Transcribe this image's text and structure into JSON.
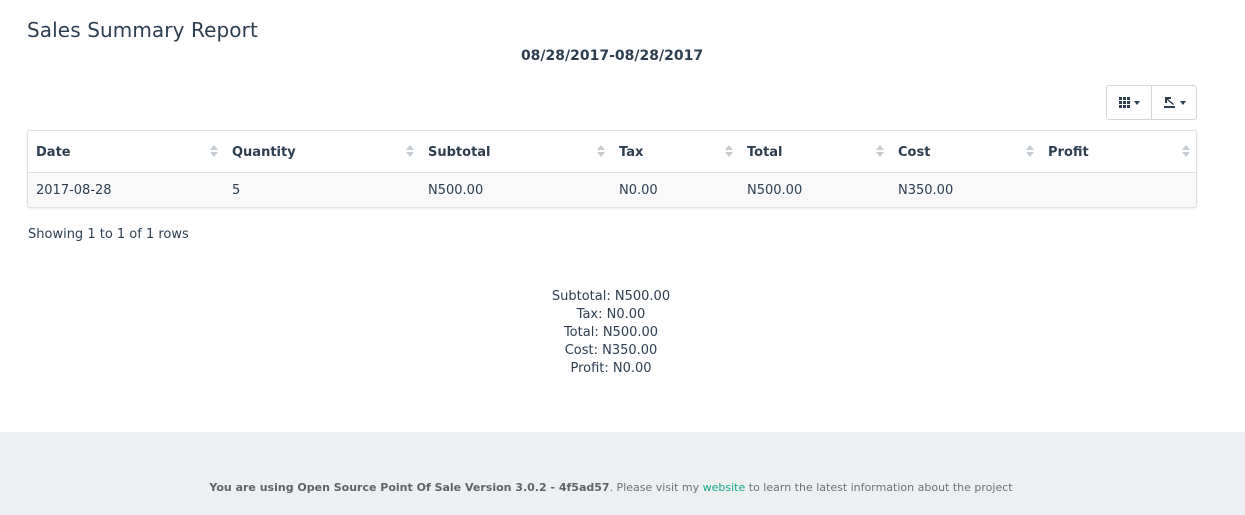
{
  "page": {
    "title": "Sales Summary Report",
    "date_range": "08/28/2017-08/28/2017"
  },
  "toolbar": {
    "columns_icon": "grid-icon",
    "export_icon": "export-icon"
  },
  "table": {
    "headers": [
      "Date",
      "Quantity",
      "Subtotal",
      "Tax",
      "Total",
      "Cost",
      "Profit"
    ],
    "rows": [
      [
        "2017-08-28",
        "5",
        "N500.00",
        "N0.00",
        "N500.00",
        "N350.00",
        ""
      ]
    ]
  },
  "pagination": {
    "showing": "Showing 1 to 1 of 1 rows"
  },
  "summary": {
    "subtotal": "Subtotal: N500.00",
    "tax": "Tax: N0.00",
    "total": "Total: N500.00",
    "cost": "Cost: N350.00",
    "profit": "Profit: N0.00"
  },
  "footer": {
    "prefix": "You are using Open Source Point Of Sale Version 3.0.2 - 4f5ad57",
    "middle": ". Please visit my ",
    "link": "website",
    "suffix": " to learn the latest information about the project"
  }
}
